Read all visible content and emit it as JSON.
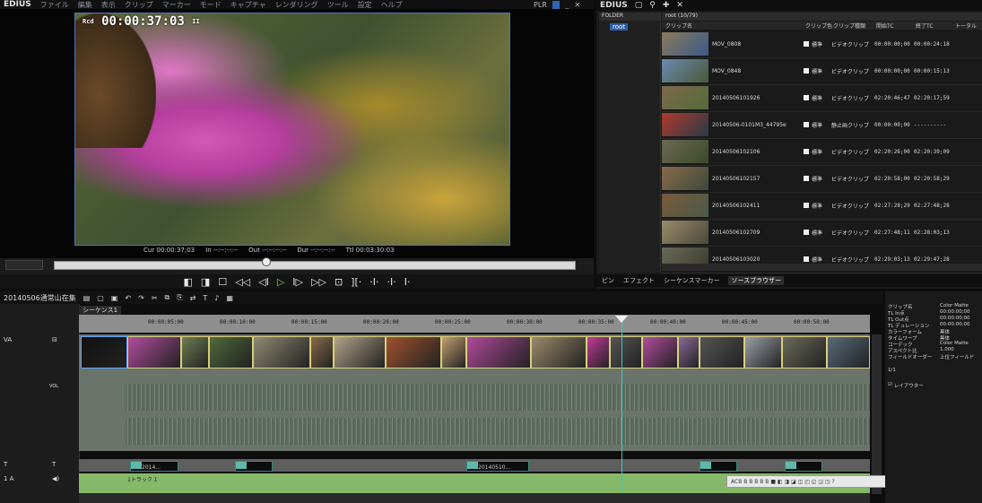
{
  "menubar": {
    "logo": "EDIUS",
    "items": [
      "ファイル",
      "編集",
      "表示",
      "クリップ",
      "マーカー",
      "モード",
      "キャプチャ",
      "レンダリング",
      "ツール",
      "設定",
      "ヘルプ"
    ],
    "pl_label": "PLR"
  },
  "player": {
    "timecode": "00:00:37:03",
    "tc_prefix": "Rcd",
    "tc_suffix": "II",
    "info": {
      "cur": "Cur 00:00:37;03",
      "in": "In --:--:--:--",
      "out": "Out --:--:--:--",
      "dur": "Dur --:--:--:--",
      "ttl": "Ttl 00:03:30:03"
    }
  },
  "transport": [
    "◧",
    "◨",
    "☐",
    "◁◁",
    "◁I",
    "▷",
    "I▷",
    "▷▷",
    "⊡",
    "][·",
    "·I·",
    "·I·",
    "I·"
  ],
  "bin": {
    "title": "EDIUS",
    "folder_header": "FOLDER",
    "folder_root": "root",
    "path": "root (10/79)",
    "headers": [
      "クリップ名",
      "クリップ色",
      "クリップ種類",
      "開始TC",
      "終了TC",
      "トータル"
    ],
    "clips": [
      {
        "name": "MOV_0808",
        "qual": "標準",
        "type": "ビデオクリップ",
        "in": "00:00:00;00",
        "out": "00:00:24:18",
        "c1": "#8a7a5a",
        "c2": "#3c5a8a"
      },
      {
        "name": "MOV_0848",
        "qual": "標準",
        "type": "ビデオクリップ",
        "in": "00:00:00;00",
        "out": "00:00:15:13",
        "c1": "#6a8ab0",
        "c2": "#4a5a3a"
      },
      {
        "name": "20140506101926",
        "qual": "標準",
        "type": "ビデオクリップ",
        "in": "02:20:46;47",
        "out": "02:20:17;59",
        "c1": "#7d6a4d",
        "c2": "#556b3a"
      },
      {
        "name": "20140506-0101M3_44795e",
        "qual": "標準",
        "type": "静止画クリップ",
        "in": "00:00:00;00",
        "out": "----------",
        "c1": "#b03a2a",
        "c2": "#2a3a4a"
      },
      {
        "name": "20140506102106",
        "qual": "標準",
        "type": "ビデオクリップ",
        "in": "02:20:26;00",
        "out": "02:20:39;09",
        "c1": "#6d6a52",
        "c2": "#3a4a2a"
      },
      {
        "name": "20140506102157",
        "qual": "標準",
        "type": "ビデオクリップ",
        "in": "02:20:58;00",
        "out": "02:20:58;29",
        "c1": "#8a6a4a",
        "c2": "#3a4a3a"
      },
      {
        "name": "20140506102411",
        "qual": "標準",
        "type": "ビデオクリップ",
        "in": "02:27:28;29",
        "out": "02:27:48;28",
        "c1": "#7a5a3a",
        "c2": "#4a5a4a"
      },
      {
        "name": "20140506102709",
        "qual": "標準",
        "type": "ビデオクリップ",
        "in": "02:27:48;11",
        "out": "02:28:03;13",
        "c1": "#9a8a6a",
        "c2": "#4a4a3a"
      },
      {
        "name": "20140506103020",
        "qual": "標準",
        "type": "ビデオクリップ",
        "in": "02:29:03;13",
        "out": "02:29:47;28",
        "c1": "#6a6a5a",
        "c2": "#3a3a2a"
      }
    ],
    "tabs": [
      "ビン",
      "エフェクト",
      "シーケンスマーカー",
      "ソースブラウザー"
    ],
    "active_tab": 3
  },
  "timeline": {
    "project": "20140506通常山在集",
    "sequence_tab": "シーケンス1",
    "ruler": [
      "00:00:05:00",
      "00:00:10:00",
      "00:00:15:00",
      "00:00:20:00",
      "00:00:25:00",
      "00:00:30:00",
      "00:00:35:00",
      "00:00:40:00",
      "00:00:45:00",
      "00:00:50:00"
    ],
    "tracks": {
      "va": "VA",
      "t": "T",
      "a1": "1 A",
      "vol": "VOL"
    },
    "t_clips": [
      "2014...",
      "",
      "20140510..."
    ],
    "a1_label": "1トラック 1",
    "mini_toolbar": "ACB  B  B  B  B  B  ■  ◧  ◨  ◪  ◫  ◰  ◱  ◲  ◳  ?"
  },
  "info_panel": {
    "rows": [
      [
        "クリップ名",
        "Color Matte"
      ],
      [
        "TL In点",
        "00:00:00;00"
      ],
      [
        "TL Out点",
        "00:00:00;00"
      ],
      [
        "TL デュレーション",
        "00:00:00;00"
      ],
      [
        "カラーフォーム",
        "黒体"
      ],
      [
        "タイムワープ",
        "黒体"
      ],
      [
        "コーデック",
        "Color Matte"
      ],
      [
        "アスペクト比",
        "1.000"
      ],
      [
        "フィールドオーダー",
        "上位フィールド"
      ]
    ],
    "page": "1/1",
    "layouter": "レイアウター"
  }
}
